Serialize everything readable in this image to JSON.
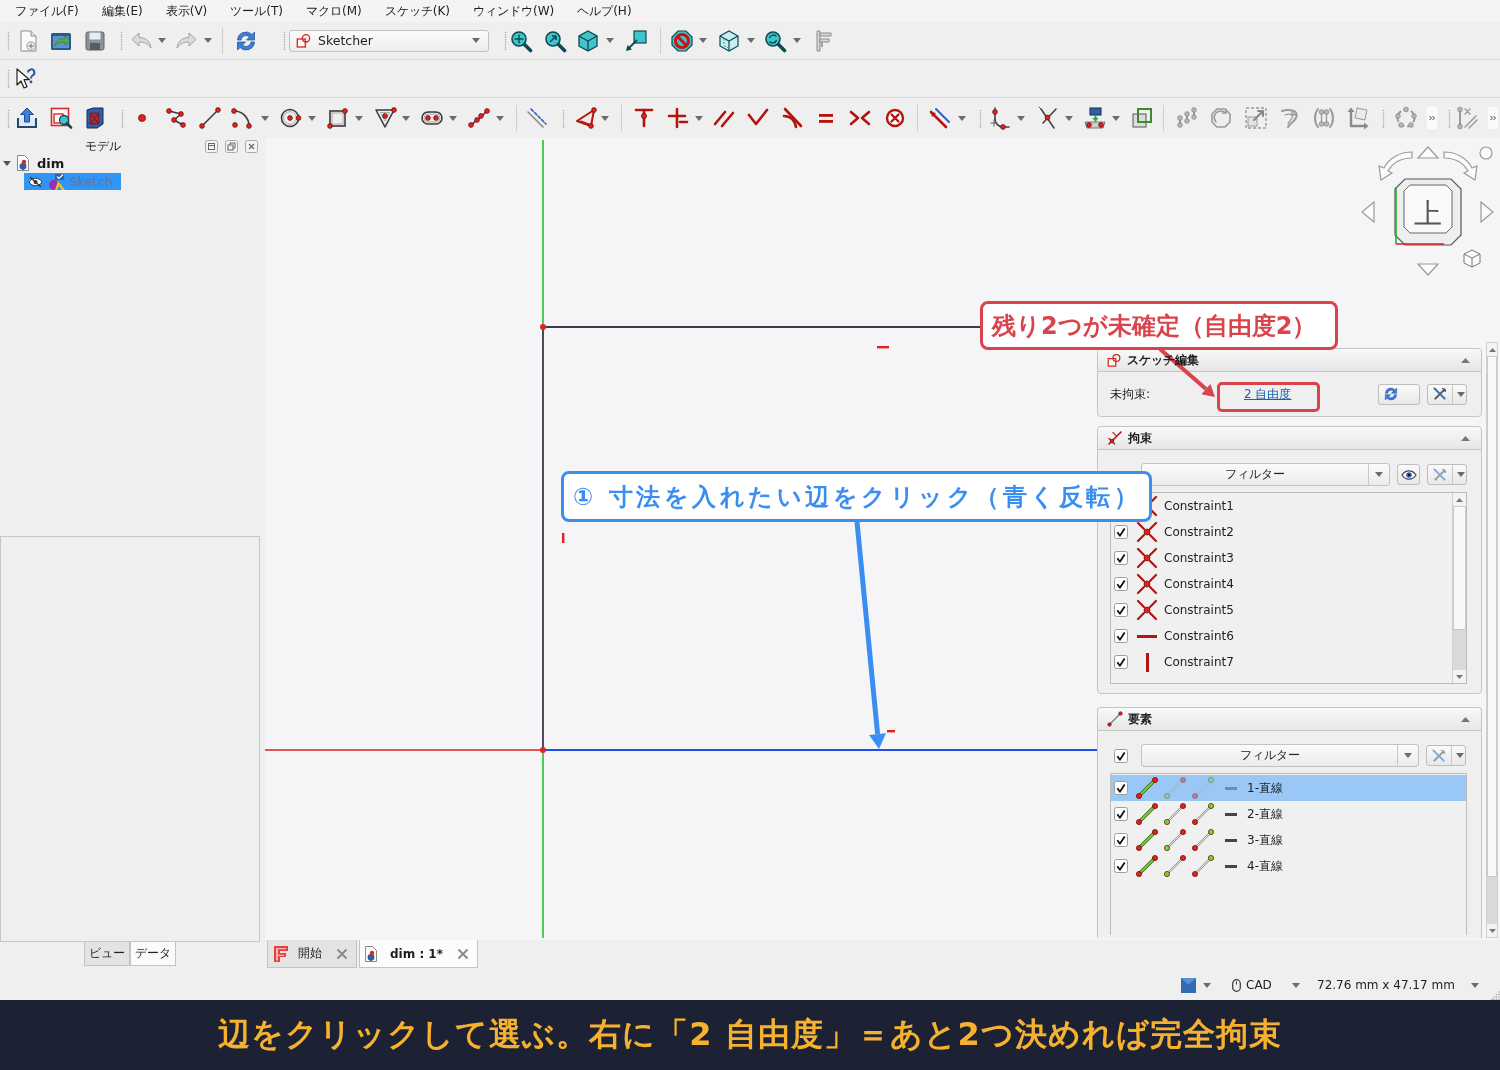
{
  "menu_bar": {
    "items": [
      "ファイル(F)",
      "編集(E)",
      "表示(V)",
      "ツール(T)",
      "マクロ(M)",
      "スケッチ(K)",
      "ウィンドウ(W)",
      "ヘルプ(H)"
    ]
  },
  "toolbar": {
    "workbench": "Sketcher"
  },
  "model_panel": {
    "title": "モデル",
    "tree": [
      {
        "label": "dim",
        "expanded": true,
        "selected": false,
        "children": [
          {
            "label": "Sketch",
            "selected": true,
            "visible": false
          }
        ]
      }
    ],
    "tabs": [
      {
        "label": "ビュー",
        "selected": false
      },
      {
        "label": "データ",
        "selected": true
      }
    ]
  },
  "view_3d": {
    "navigation_cube": {
      "face": "上"
    }
  },
  "task_panel": {
    "sketch_edit": {
      "title": "スケッチ編集",
      "expanded": true,
      "label": "未拘束:",
      "link": "2 自由度"
    },
    "constraints": {
      "title": "拘束",
      "expanded": true,
      "filter": "フィルター",
      "items": [
        {
          "name": "Constraint1",
          "kind": "coincident"
        },
        {
          "name": "Constraint2",
          "kind": "coincident",
          "checked": true
        },
        {
          "name": "Constraint3",
          "kind": "coincident",
          "checked": true
        },
        {
          "name": "Constraint4",
          "kind": "coincident",
          "checked": true
        },
        {
          "name": "Constraint5",
          "kind": "coincident",
          "checked": true
        },
        {
          "name": "Constraint6",
          "kind": "horizontal",
          "checked": true
        },
        {
          "name": "Constraint7",
          "kind": "vertical",
          "checked": true
        }
      ]
    },
    "elements": {
      "title": "要素",
      "expanded": true,
      "filter": "フィルター",
      "all_checked": true,
      "items": [
        {
          "name": "1-直線",
          "checked": true,
          "selected": true
        },
        {
          "name": "2-直線",
          "checked": true,
          "selected": false
        },
        {
          "name": "3-直線",
          "checked": true,
          "selected": false
        },
        {
          "name": "4-直線",
          "checked": true,
          "selected": false
        }
      ]
    }
  },
  "document_tabs": [
    {
      "label": "開始",
      "selected": false
    },
    {
      "label": "dim : 1*",
      "selected": true
    }
  ],
  "status_bar": {
    "navigation_style": "CAD",
    "dimensions": "72.76 mm x 47.17 mm"
  },
  "annotations": [
    {
      "kind": "callout",
      "text": "残り2つが未確定（自由度2）",
      "color": "#d9434b"
    },
    {
      "kind": "frame",
      "color": "#d9434b"
    },
    {
      "kind": "callout",
      "text": "① 寸法を入れたい辺をクリック（青く反転）",
      "color": "#3a8ef2"
    }
  ],
  "caption": {
    "text": "辺をクリックして選ぶ。右に「2 自由度」＝あと2つ決めれば完全拘束"
  }
}
